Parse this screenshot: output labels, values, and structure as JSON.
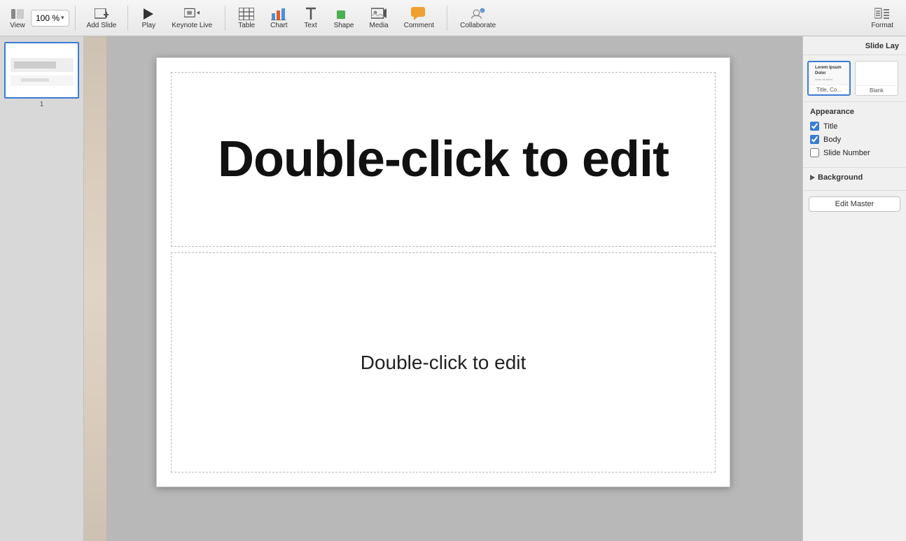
{
  "toolbar": {
    "view_label": "View",
    "zoom_value": "100 %",
    "zoom_chevron": "▾",
    "add_slide_label": "Add Slide",
    "play_label": "Play",
    "keynote_live_label": "Keynote Live",
    "table_label": "Table",
    "chart_label": "Chart",
    "text_label": "Text",
    "shape_label": "Shape",
    "media_label": "Media",
    "comment_label": "Comment",
    "collaborate_label": "Collaborate",
    "format_label": "Format"
  },
  "right_panel": {
    "header": "Slide Lay",
    "layout_cards": [
      {
        "id": "title-body",
        "label": "Title, Co...",
        "selected": true
      },
      {
        "id": "blank",
        "label": "Blank",
        "selected": false
      }
    ],
    "appearance": {
      "title": "Appearance",
      "title_checked": true,
      "body_checked": true,
      "slide_number_checked": false,
      "title_label": "Title",
      "body_label": "Body",
      "slide_number_label": "Slide Number"
    },
    "background": {
      "label": "Background"
    },
    "edit_master_label": "Edit Master"
  },
  "slide": {
    "number": "1",
    "title_placeholder": "Double-click to edit",
    "body_placeholder": "Double-click to edit"
  }
}
